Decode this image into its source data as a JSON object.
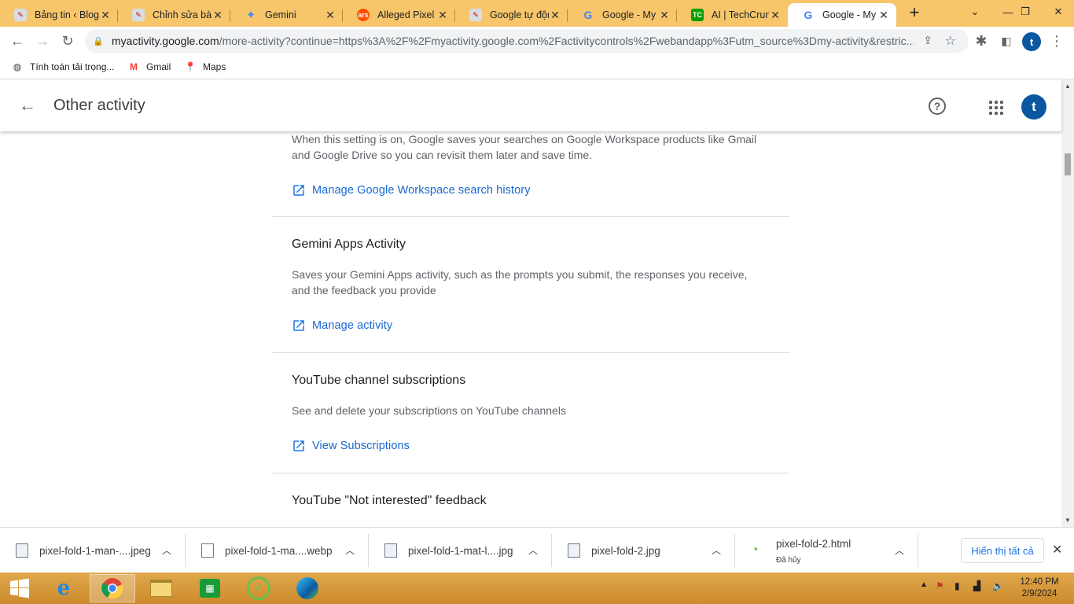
{
  "tabs": [
    {
      "title": "Bảng tin ‹ Blog",
      "favicon": "wordpress-site-icon",
      "color": "#d8dde3"
    },
    {
      "title": "Chỉnh sửa bài",
      "favicon": "wordpress-site-icon",
      "color": "#d8dde3"
    },
    {
      "title": "Gemini",
      "favicon": "gemini-sparkle-icon",
      "color": "#4a88f5"
    },
    {
      "title": "Alleged Pixel F",
      "favicon": "ars-technica-icon",
      "color": "#ff4e00"
    },
    {
      "title": "Google tự độn",
      "favicon": "wordpress-site-icon",
      "color": "#d8dde3"
    },
    {
      "title": "Google - My A",
      "favicon": "google-g-icon",
      "color": "#4285f4"
    },
    {
      "title": "AI | TechCrunc",
      "favicon": "techcrunch-icon",
      "color": "#0a9e01"
    },
    {
      "title": "Google - My A",
      "favicon": "google-g-icon",
      "color": "#4285f4"
    }
  ],
  "toolbar": {
    "url_host": "myactivity.google.com",
    "url_rest": "/more-activity?continue=https%3A%2F%2Fmyactivity.google.com%2Factivitycontrols%2Fwebandapp%3Futm_source%3Dmy-activity&restric...",
    "profile_initial": "t"
  },
  "bookmarks": [
    {
      "label": "Tính toán tải trọng...",
      "icon": "globe-icon"
    },
    {
      "label": "Gmail",
      "icon": "gmail-icon"
    },
    {
      "label": "Maps",
      "icon": "maps-pin-icon"
    }
  ],
  "page": {
    "title": "Other activity",
    "avatar_initial": "t",
    "sections": [
      {
        "title": "",
        "description": "When this setting is on, Google saves your searches on Google Workspace products like Gmail and Google Drive so you can revisit them later and save time.",
        "link": "Manage Google Workspace search history"
      },
      {
        "title": "Gemini Apps Activity",
        "description": "Saves your Gemini Apps activity, such as the prompts you submit, the responses you receive, and the feedback you provide",
        "link": "Manage activity"
      },
      {
        "title": "YouTube channel subscriptions",
        "description": "See and delete your subscriptions on YouTube channels",
        "link": "View Subscriptions"
      },
      {
        "title": "YouTube \"Not interested\" feedback",
        "description": "",
        "link": ""
      }
    ]
  },
  "downloads": [
    {
      "name": "pixel-fold-1-man-....jpeg",
      "status": ""
    },
    {
      "name": "pixel-fold-1-ma....webp",
      "status": ""
    },
    {
      "name": "pixel-fold-1-mat-l....jpg",
      "status": ""
    },
    {
      "name": "pixel-fold-2.jpg",
      "status": ""
    },
    {
      "name": "pixel-fold-2.html",
      "status": "Đã hủy"
    }
  ],
  "downloads_show_all": "Hiển thị tất cả",
  "taskbar": {
    "time": "12:40 PM",
    "date": "2/9/2024"
  },
  "colors": {
    "accent": "#1a73e8",
    "tabstrip": "#f7c66a",
    "taskbar": "#d89a3a",
    "avatar": "#0b57a0"
  }
}
